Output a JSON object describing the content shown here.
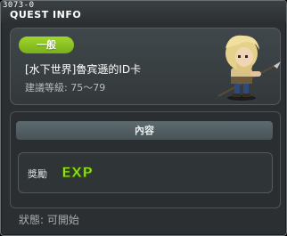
{
  "window": {
    "quest_id": "3073-0",
    "title": "QUEST INFO"
  },
  "quest": {
    "category_badge": "一般",
    "name": "[水下世界]魯宾遜的ID卡",
    "level_text": "建議等級: 75〜79"
  },
  "content": {
    "header": "內容",
    "reward_label": "獎勵",
    "reward_icon": "exp-icon",
    "reward_icon_text": "EXP"
  },
  "footer": {
    "status_text": "狀態: 可開始"
  },
  "colors": {
    "badge_green": "#8cc820",
    "exp_green": "#9be21f",
    "window_bg": "#2b2f31"
  }
}
